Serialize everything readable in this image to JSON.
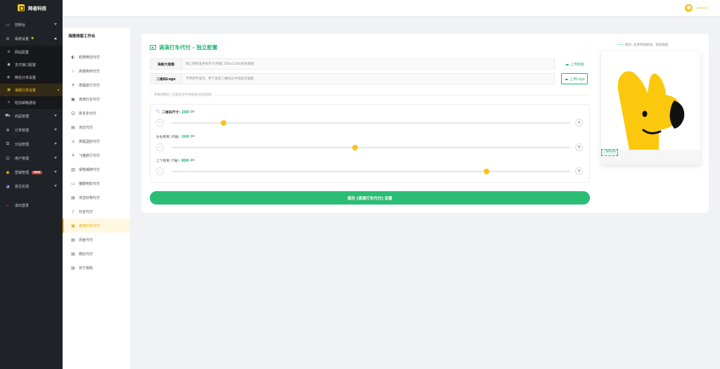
{
  "brand": {
    "name": "网者科技"
  },
  "sidebar": {
    "items": [
      {
        "label": "控制台",
        "icon": "dashboard-icon",
        "arrow": "down"
      },
      {
        "label": "系统设置",
        "icon": "gear-icon",
        "arrow": "up",
        "expanded": true
      },
      {
        "label": "商品管理",
        "icon": "cart-icon",
        "arrow": "down"
      },
      {
        "label": "订单管理",
        "icon": "order-icon",
        "arrow": "down"
      },
      {
        "label": "分站管理",
        "icon": "branch-icon",
        "arrow": "down"
      },
      {
        "label": "用户管理",
        "icon": "user-icon",
        "arrow": "down"
      },
      {
        "label": "营销管理",
        "icon": "marketing-icon",
        "arrow": "down",
        "badge": "NEW"
      },
      {
        "label": "意见反馈",
        "icon": "feedback-icon",
        "arrow": "down"
      },
      {
        "label": "退出登录",
        "icon": "logout-icon"
      }
    ],
    "system_sub": [
      {
        "label": "网站配置",
        "icon": "settings-icon"
      },
      {
        "label": "支付接口配置",
        "icon": "payment-icon"
      },
      {
        "label": "微信分享设置",
        "icon": "wechat-icon"
      },
      {
        "label": "海报分享设置",
        "icon": "poster-icon",
        "active": true
      },
      {
        "label": "短信邮箱通道",
        "icon": "message-icon"
      }
    ]
  },
  "topbar": {
    "user": "admin"
  },
  "workbench": {
    "title": "海报排版工作台",
    "items": [
      {
        "label": "经典微信代付",
        "icon": "wechat-icon"
      },
      {
        "label": "高端电商代付",
        "icon": "star-icon"
      },
      {
        "label": "携程旅行代付",
        "icon": "plane-icon"
      },
      {
        "label": "滴滴打车代付",
        "icon": "image-icon"
      },
      {
        "label": "拼多多代付",
        "icon": "user-icon"
      },
      {
        "label": "淘宝代付",
        "icon": "doc-icon"
      },
      {
        "label": "携程酒店代付",
        "icon": "home-icon"
      },
      {
        "label": "飞猪旅行代付",
        "icon": "plane-icon"
      },
      {
        "label": "得物潮牌代付",
        "icon": "tag-icon"
      },
      {
        "label": "猫眼电影代付",
        "icon": "ticket-icon"
      },
      {
        "label": "淘宝好物代付",
        "icon": "doc-icon"
      },
      {
        "label": "抖音代付",
        "icon": "music-icon"
      },
      {
        "label": "滴滴打车代付",
        "icon": "image-icon",
        "active": true
      },
      {
        "label": "闲鱼代付",
        "icon": "doc-icon"
      },
      {
        "label": "微店代付",
        "icon": "doc-icon"
      },
      {
        "label": "苏宁易购",
        "icon": "doc-icon"
      }
    ]
  },
  "panel": {
    "title": "滴滴打车代付 - 独立配置",
    "bg_label": "海报大底图",
    "bg_placeholder": "请上传标准手机尺寸(例如 750x1334)的背景图",
    "bg_btn": "上传底图",
    "logo_label": "二维码Logo",
    "logo_placeholder": "不传则不显示，传了会在二维码正中间显示该图",
    "logo_btn": "上传Logo",
    "divider": "参数调整区 (全面支持手指拖拽/双指缩放)",
    "sliders": [
      {
        "label": "二维码尺寸:",
        "value": "200",
        "unit": "px",
        "icon": "search-icon",
        "level": 0.13
      },
      {
        "label": "左右距离 (X轴):",
        "value": "260",
        "unit": "px",
        "level": 0.46
      },
      {
        "label": "上下距离 (Y轴):",
        "value": "800",
        "unit": "px",
        "level": 0.79
      }
    ],
    "save": "保存 [滴滴打车代付] 设置",
    "tip": "提示: 支持单指拖动、双指缩放",
    "qr_tag": "二维码区域"
  },
  "colors": {
    "accent": "#f5c518",
    "green": "#22b573",
    "sidebar": "#1f2227"
  }
}
